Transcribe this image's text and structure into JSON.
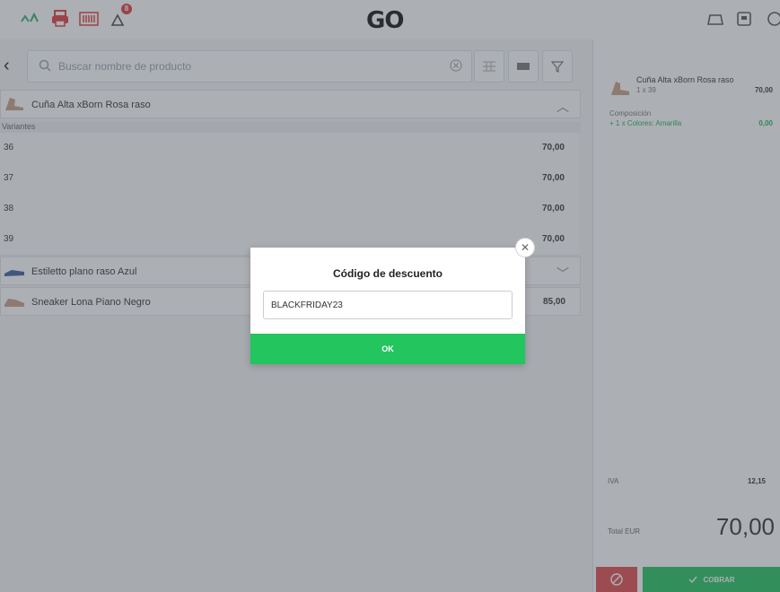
{
  "topbar": {
    "logo": "GO",
    "notifications_count": "8"
  },
  "search": {
    "placeholder": "Buscar nombre de producto"
  },
  "groups": [
    {
      "name": "Cuña Alta xBorn Rosa raso",
      "chevron": "up"
    },
    {
      "name": "Estiletto plano raso Azul",
      "chevron": "down"
    },
    {
      "name": "Sneaker Lona Piano Negro",
      "price": "85,00"
    }
  ],
  "variants": {
    "header": "Variantes",
    "rows": [
      {
        "name": "36",
        "price": "70,00"
      },
      {
        "name": "37",
        "price": "70,00"
      },
      {
        "name": "38",
        "price": "70,00"
      },
      {
        "name": "39",
        "price": "70,00"
      }
    ]
  },
  "cart": {
    "item_name": "Cuña Alta xBorn Rosa raso",
    "item_sub": "1 x 39",
    "item_price": "70,00",
    "composition_label": "Composición",
    "composition_item": "+ 1 x Colores: Amarilla",
    "composition_price": "0,00",
    "iva_label": "IVA",
    "iva_value": "12,15",
    "total_label": "Total EUR",
    "total_value": "70,00",
    "charge_label": "COBRAR"
  },
  "modal": {
    "title": "Código de descuento",
    "input_value": "BLACKFRIDAY23",
    "ok_label": "OK"
  },
  "colors": {
    "accent_green": "#22c55e",
    "danger_red": "#e24c4c",
    "brand_red": "#e23b3b"
  }
}
